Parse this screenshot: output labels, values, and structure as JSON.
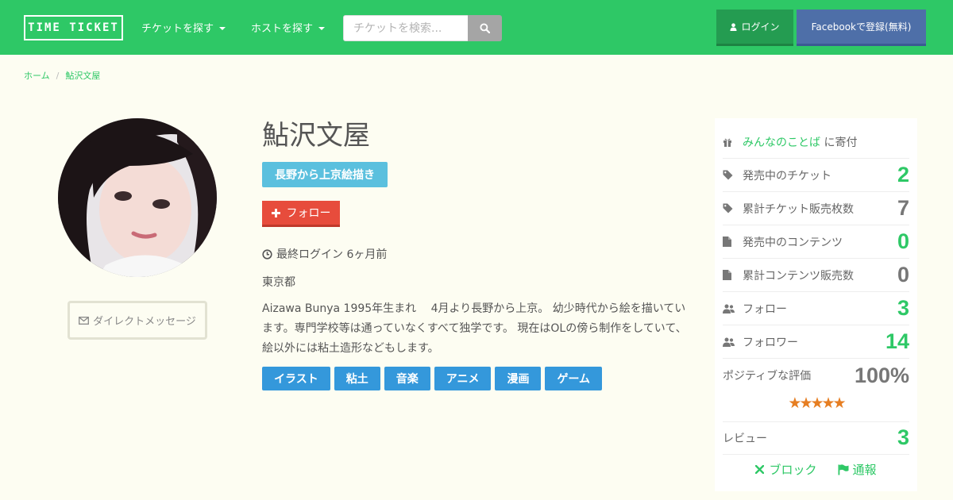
{
  "header": {
    "logo_text": "TIME TICKET",
    "nav": [
      {
        "label": "チケットを探す"
      },
      {
        "label": "ホストを探す"
      }
    ],
    "search_placeholder": "チケットを検索...",
    "login_label": "ログイン",
    "facebook_label": "Facebookで登録(無料)",
    "colors": {
      "header_bg": "#2ec866",
      "login_bg": "#249c51",
      "facebook_bg": "#4e6fa8"
    }
  },
  "breadcrumb": {
    "items": [
      "ホーム",
      "鮎沢文屋"
    ]
  },
  "profile": {
    "name": "鮎沢文屋",
    "catchphrase": "長野から上京絵描き",
    "follow_label": "フォロー",
    "last_login": "最終ログイン 6ヶ月前",
    "location": "東京都",
    "bio": "Aizawa Bunya 1995年生まれ　 4月より長野から上京。 幼少時代から絵を描いています。専門学校等は通っていなくすべて独学です。 現在はOLの傍ら制作をしていて、絵以外には粘土造形などもします。",
    "tags": [
      "イラスト",
      "粘土",
      "音楽",
      "アニメ",
      "漫画",
      "ゲーム"
    ],
    "dm_label": "ダイレクトメッセージ"
  },
  "stats": {
    "donate": {
      "link": "みんなのことば",
      "suffix": " に寄付"
    },
    "rows": [
      {
        "label": "発売中のチケット",
        "value": "2",
        "icon": "tag-icon"
      },
      {
        "label": "累計チケット販売枚数",
        "value": "7",
        "icon": "tag-icon"
      },
      {
        "label": "発売中のコンテンツ",
        "value": "0",
        "icon": "file-icon"
      },
      {
        "label": "累計コンテンツ販売数",
        "value": "0",
        "icon": "file-icon"
      },
      {
        "label": "フォロー",
        "value": "3",
        "icon": "users-icon"
      },
      {
        "label": "フォロワー",
        "value": "14",
        "icon": "users-icon"
      }
    ],
    "positive_label": "ポジティブな評価",
    "positive_value": "100%",
    "rating_stars": 5,
    "stars_text": "★★★★★",
    "review_label": "レビュー",
    "review_value": "3",
    "block_label": "ブロック",
    "report_label": "通報"
  }
}
